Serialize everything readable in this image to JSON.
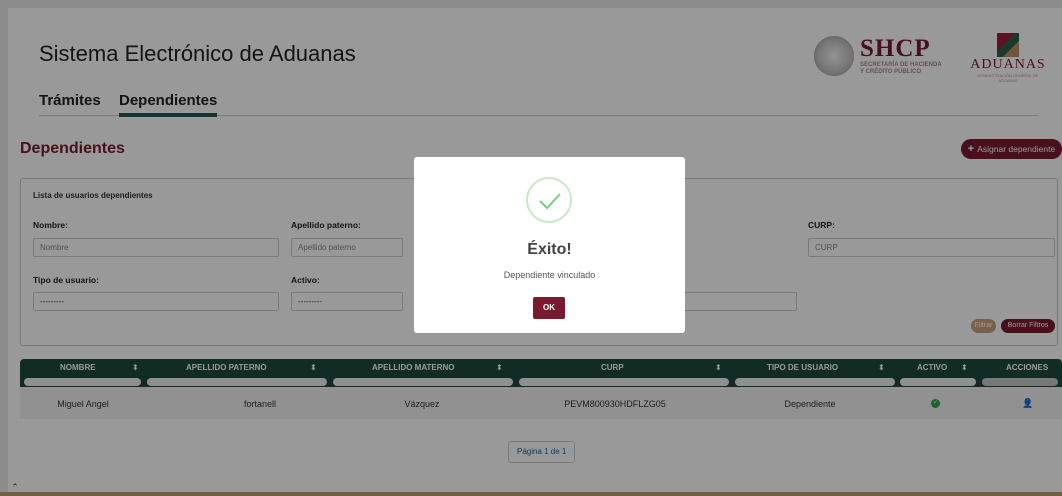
{
  "header": {
    "app_title": "Sistema Electrónico de Aduanas",
    "shcp": {
      "name": "SHCP",
      "line1": "SECRETARÍA DE HACIENDA",
      "line2": "Y CRÉDITO PÚBLICO"
    },
    "aduanas": {
      "name": "ADUANAS",
      "tagline": "ADMINISTRACIÓN GENERAL DE ADUANAS"
    }
  },
  "tabs": [
    {
      "label": "Trámites"
    },
    {
      "label": "Dependientes"
    }
  ],
  "section": {
    "title": "Dependientes",
    "assign_label": "Asignar dependiente"
  },
  "filters": {
    "title": "Lista de usuarios dependientes",
    "nombre": {
      "label": "Nombre:",
      "placeholder": "Nombre"
    },
    "apellido_paterno": {
      "label": "Apellido paterno:",
      "placeholder": "Apellido paterno"
    },
    "curp": {
      "label": "CURP:",
      "placeholder": "CURP"
    },
    "tipo_usuario": {
      "label": "Tipo de usuario:",
      "value": "---------"
    },
    "activo": {
      "label": "Activo:",
      "value": "---------"
    },
    "filter_label": "Filtrar",
    "clear_label": "Borrar Filtros"
  },
  "table": {
    "columns": [
      "NOMBRE",
      "APELLIDO PATERNO",
      "APELLIDO MATERNO",
      "CURP",
      "TIPO DE USUARIO",
      "ACTIVO",
      "ACCIONES"
    ],
    "rows": [
      {
        "nombre": "Miguel Angel",
        "apellido_paterno": "fortanell",
        "apellido_materno": "Vázquez",
        "curp": "PEVM800930HDFLZG05",
        "tipo": "Dependiente",
        "activo": true
      }
    ]
  },
  "pager": {
    "label": "Página 1 de 1"
  },
  "modal": {
    "title": "Éxito!",
    "message": "Dependiente vinculado",
    "ok_label": "OK"
  },
  "colors": {
    "brand": "#7a1a30",
    "green": "#1d4a3f",
    "gold": "#c9a27c"
  }
}
